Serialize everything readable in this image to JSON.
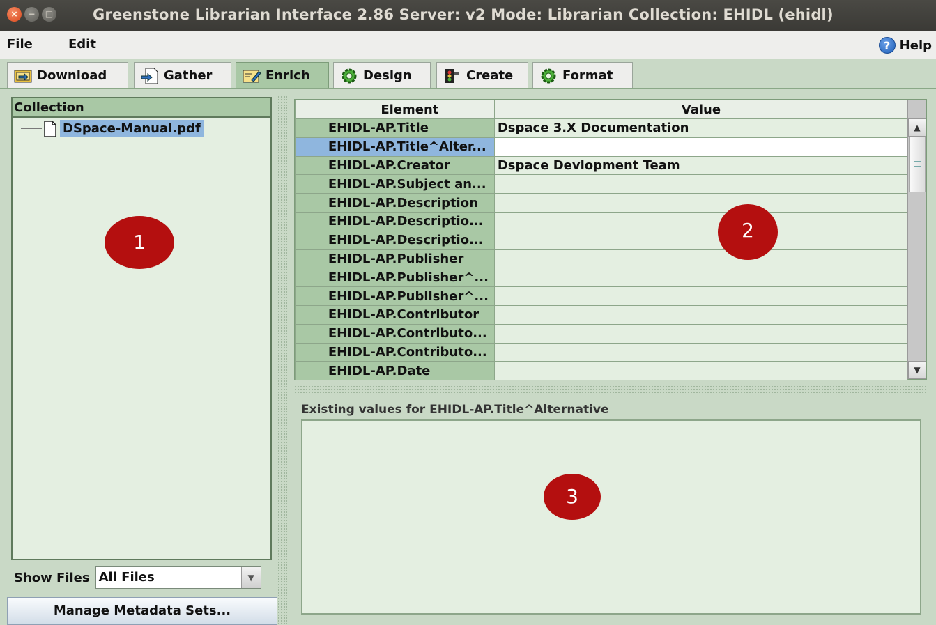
{
  "window": {
    "title": "Greenstone Librarian Interface 2.86  Server: v2  Mode: Librarian  Collection: EHIDL (ehidl)",
    "close_glyph": "×",
    "min_glyph": "−",
    "max_glyph": "□"
  },
  "menu": {
    "file": "File",
    "edit": "Edit",
    "help": "Help",
    "help_glyph": "?"
  },
  "tabs": [
    {
      "label": "Download",
      "icon": "download-icon"
    },
    {
      "label": "Gather",
      "icon": "gather-icon"
    },
    {
      "label": "Enrich",
      "icon": "enrich-icon",
      "active": true
    },
    {
      "label": "Design",
      "icon": "design-gear-icon"
    },
    {
      "label": "Create",
      "icon": "create-icon"
    },
    {
      "label": "Format",
      "icon": "format-gear-icon"
    }
  ],
  "collection": {
    "header": "Collection",
    "file": "DSpace-Manual.pdf",
    "show_files_label": "Show Files",
    "show_files_value": "All Files",
    "manage_button": "Manage Metadata Sets..."
  },
  "metadata_table": {
    "col_element": "Element",
    "col_value": "Value",
    "selected_row": 1,
    "rows": [
      {
        "element": "EHIDL-AP.Title",
        "value": "Dspace 3.X Documentation"
      },
      {
        "element": "EHIDL-AP.Title^Alter...",
        "value": ""
      },
      {
        "element": "EHIDL-AP.Creator",
        "value": "Dspace Devlopment Team"
      },
      {
        "element": "EHIDL-AP.Subject an...",
        "value": ""
      },
      {
        "element": "EHIDL-AP.Description",
        "value": ""
      },
      {
        "element": "EHIDL-AP.Descriptio...",
        "value": ""
      },
      {
        "element": "EHIDL-AP.Descriptio...",
        "value": ""
      },
      {
        "element": "EHIDL-AP.Publisher",
        "value": ""
      },
      {
        "element": "EHIDL-AP.Publisher^...",
        "value": ""
      },
      {
        "element": "EHIDL-AP.Publisher^...",
        "value": ""
      },
      {
        "element": "EHIDL-AP.Contributor",
        "value": ""
      },
      {
        "element": "EHIDL-AP.Contributo...",
        "value": ""
      },
      {
        "element": "EHIDL-AP.Contributo...",
        "value": ""
      },
      {
        "element": "EHIDL-AP.Date",
        "value": ""
      }
    ]
  },
  "existing_values": {
    "label": "Existing values for EHIDL-AP.Title^Alternative"
  },
  "markers": [
    "1",
    "2",
    "3"
  ],
  "colors": {
    "marker": "#b40f0f",
    "panel_green": "#a9c8a5",
    "selection_blue": "#8fb6de"
  }
}
